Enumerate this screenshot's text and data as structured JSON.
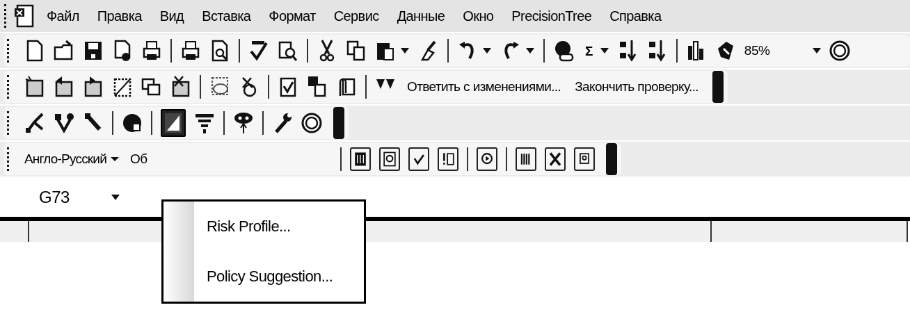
{
  "menu_bar": {
    "items": [
      "Файл",
      "Правка",
      "Вид",
      "Вставка",
      "Формат",
      "Сервис",
      "Данные",
      "Окно",
      "PrecisionTree",
      "Справка"
    ]
  },
  "standard_toolbar": {
    "autosum": "Σ",
    "zoom": "85%"
  },
  "reviewing_toolbar": {
    "buttons": [
      "Ответить с изменениями...",
      "Закончить проверку..."
    ]
  },
  "precisiontree_toolbar": {
    "chart_button": {
      "pressed": true
    }
  },
  "dictionary_toolbar": {
    "dictionary": "Англо-Русский",
    "item_2": "Об"
  },
  "name_box": {
    "value": "G73"
  },
  "popup_menu": {
    "items": [
      "Risk Profile...",
      "Policy Suggestion..."
    ]
  }
}
